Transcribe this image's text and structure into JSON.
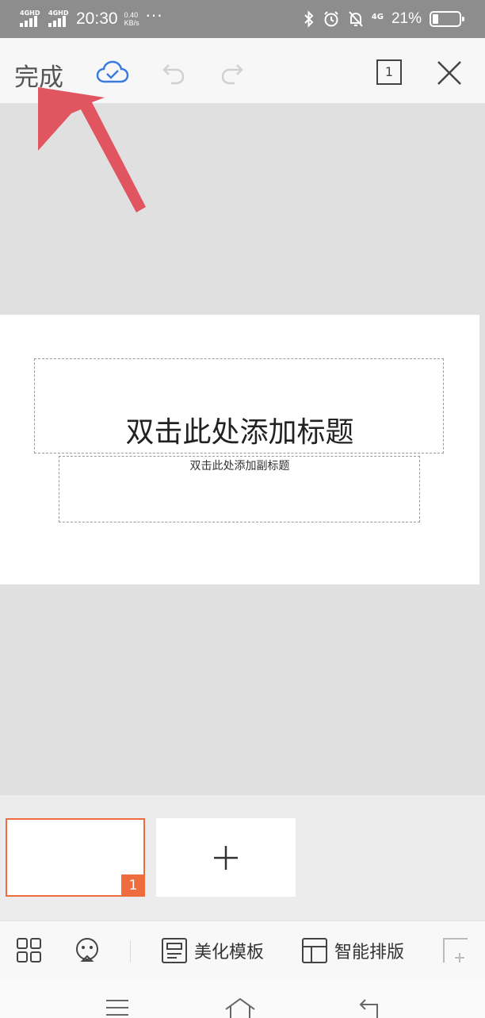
{
  "status_bar": {
    "signal1": "4GHD",
    "signal2": "4GHD",
    "time": "20:30",
    "speed_value": "0.40",
    "speed_unit": "KB/s",
    "more": "···",
    "network": "4G",
    "battery_percent": "21%",
    "battery_level": 0.21
  },
  "toolbar": {
    "done_label": "完成",
    "page_count": "1",
    "accent": "#3b7be0"
  },
  "slide": {
    "title_placeholder": "双击此处添加标题",
    "subtitle_placeholder": "双击此处添加副标题"
  },
  "thumbnails": {
    "items": [
      {
        "number": "1"
      }
    ],
    "accent": "#ef6c3f"
  },
  "bottom_tools": {
    "beautify_label": "美化模板",
    "layout_label": "智能排版"
  },
  "annotation": {
    "color": "#e0555f"
  }
}
